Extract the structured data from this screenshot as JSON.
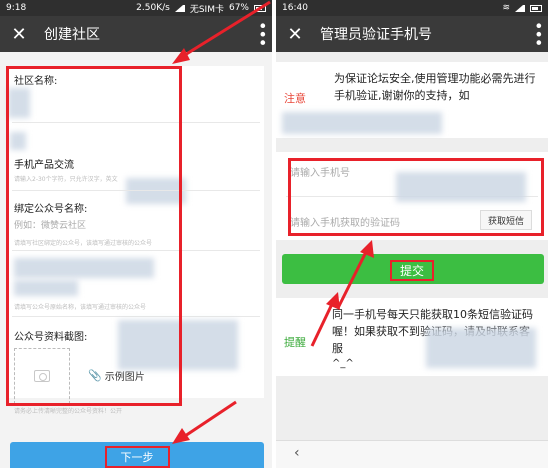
{
  "left": {
    "status": {
      "time": "9:18",
      "speed": "2.50K/s",
      "carrier": "无SIM卡",
      "battery": "67%"
    },
    "title": "创建社区",
    "close_icon": "close-icon",
    "more_icon": "more-vertical-icon",
    "form": {
      "community_name_label": "社区名称:",
      "product_value": "手机产品交流",
      "product_hint": "请输入2-30个字符，只允许汉字，英文",
      "bind_account_label": "绑定公众号名称:",
      "bind_account_placeholder": "例如：微赞云社区",
      "bind_account_hint": "请填写社区绑定的公众号，该填写通过审核的公众号",
      "account_hint": "请填写公众号原始名称，该填写通过审核的公众号",
      "screenshot_label": "公众号资料截图:",
      "sample_link": "示例图片",
      "upload_hint": "请务必上传清晰完整的公众号资料！公开"
    },
    "next_button": "下一步"
  },
  "right": {
    "status": {
      "time": "16:40"
    },
    "title": "管理员验证手机号",
    "close_icon": "close-icon",
    "more_icon": "more-vertical-icon",
    "notice_head": "注意",
    "notice_text": "为保证论坛安全,使用管理功能必需先进行手机验证,谢谢你的支持，如",
    "phone_placeholder": "请输入手机号",
    "code_placeholder": "请输入手机获取的验证码",
    "sms_button": "获取短信",
    "submit_button": "提交",
    "tips_head": "提醒",
    "tips_text": "同一手机号每天只能获取10条短信验证码喔！如果获取不到验证码，请及时联系客服",
    "tips_emote": "^_^",
    "back_icon": "back-arrow-icon"
  },
  "colors": {
    "highlight": "#e8212a",
    "blue_button": "#3ea3e6",
    "green_button": "#3cbe42",
    "titlebar": "#3a3a3a"
  }
}
